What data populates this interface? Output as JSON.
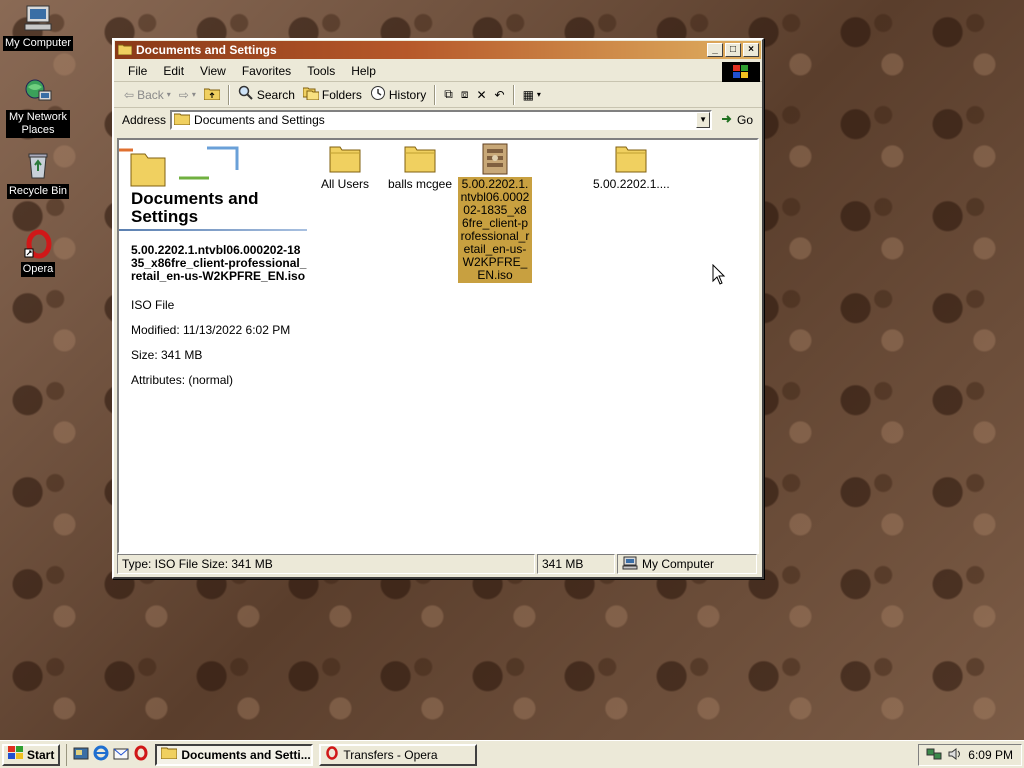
{
  "desktop": {
    "icons": [
      {
        "label": "My Computer"
      },
      {
        "label": "My Network Places"
      },
      {
        "label": "Recycle Bin"
      },
      {
        "label": "Opera"
      }
    ]
  },
  "window": {
    "title": "Documents and Settings",
    "menu": [
      "File",
      "Edit",
      "View",
      "Favorites",
      "Tools",
      "Help"
    ],
    "toolbar": {
      "back": "Back",
      "search": "Search",
      "folders": "Folders",
      "history": "History"
    },
    "address": {
      "label": "Address",
      "value": "Documents and Settings",
      "go": "Go"
    },
    "left_pane": {
      "title": "Documents and Settings",
      "file_name": "5.00.2202.1.ntvbl06.000202-1835_x86fre_client-professional_retail_en-us-W2KPFRE_EN.iso",
      "file_type": "ISO File",
      "modified": "Modified: 11/13/2022 6:02 PM",
      "size": "Size: 341 MB",
      "attributes": "Attributes: (normal)"
    },
    "items": [
      {
        "name": "All Users"
      },
      {
        "name": "balls mcgee"
      },
      {
        "name": "5.00.2202.1.ntvbl06.000202-1835_x86fre_client-professional_retail_en-us-W2KPFRE_EN.iso"
      },
      {
        "name": "5.00.2202.1...."
      }
    ],
    "status": {
      "type_text": "Type: ISO File Size: 341 MB",
      "size": "341 MB",
      "zone": "My Computer"
    }
  },
  "taskbar": {
    "start": "Start",
    "tasks": [
      "Documents and Setti...",
      "Transfers - Opera"
    ],
    "clock": "6:09 PM"
  },
  "colors": {
    "title_start": "#8a3a18",
    "title_end": "#e0b060",
    "selection": "#c8a040",
    "chrome": "#ece9d8"
  }
}
